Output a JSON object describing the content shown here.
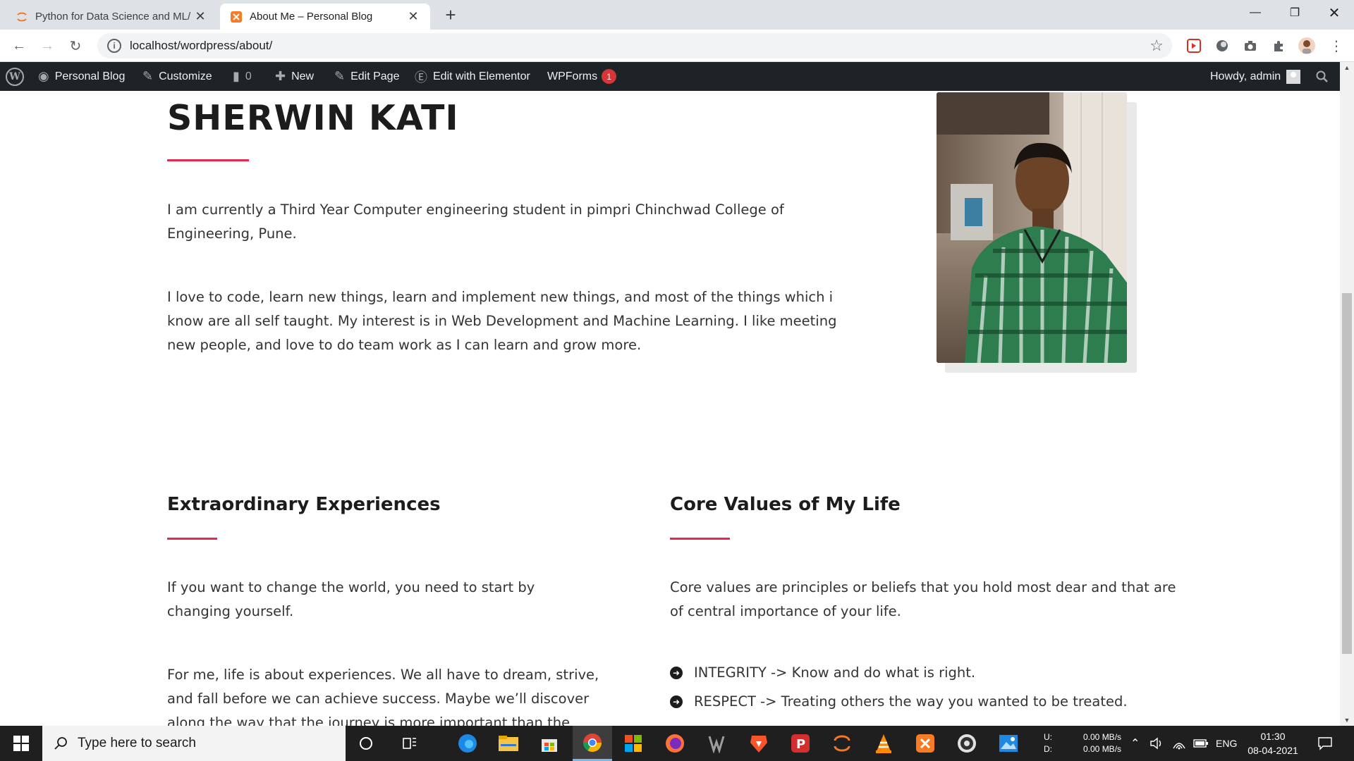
{
  "browser": {
    "tabs": [
      {
        "title": "Python for Data Science and ML/",
        "active": false
      },
      {
        "title": "About Me – Personal Blog",
        "active": true
      }
    ],
    "address": {
      "url": "localhost/wordpress/about/"
    }
  },
  "adminbar": {
    "site_name": "Personal Blog",
    "customize": "Customize",
    "comments_count": "0",
    "new": "New",
    "edit_page": "Edit Page",
    "edit_elementor": "Edit with Elementor",
    "wpforms": "WPForms",
    "wpforms_badge": "1",
    "howdy": "Howdy, admin"
  },
  "page": {
    "name": "SHERWIN KATI",
    "intro": [
      "I am currently a Third Year Computer engineering student in pimpri Chinchwad College of Engineering, Pune.",
      "I love to code, learn new things, learn and implement new things, and most of the things which i know are all self taught. My interest is in Web Development and Machine Learning. I like meeting new people, and love to do team work as I can learn and grow more."
    ],
    "experiences": {
      "heading": "Extraordinary Experiences",
      "paragraphs": [
        "If you want to change the world, you need to start by changing yourself.",
        "For me, life is about experiences. We all have to dream, strive, and fall before we can achieve success. Maybe we’ll discover along the way that the journey is more important than the"
      ]
    },
    "values": {
      "heading": "Core Values of My Life",
      "paragraph": "Core values are principles or beliefs that you hold most dear and that are of central importance of your life.",
      "items": [
        "INTEGRITY -> Know and do what is right.",
        "RESPECT -> Treating others the way you wanted to be treated."
      ]
    }
  },
  "taskbar": {
    "search_placeholder": "Type here to search",
    "net_up_label": "U:",
    "net_down_label": "D:",
    "net_up": "0.00 MB/s",
    "net_down": "0.00 MB/s",
    "language": "ENG",
    "time": "01:30",
    "date": "08-04-2021"
  },
  "colors": {
    "accent": "#e5284d",
    "adminbar": "#1d2327",
    "taskbar": "#1f1f1f"
  }
}
